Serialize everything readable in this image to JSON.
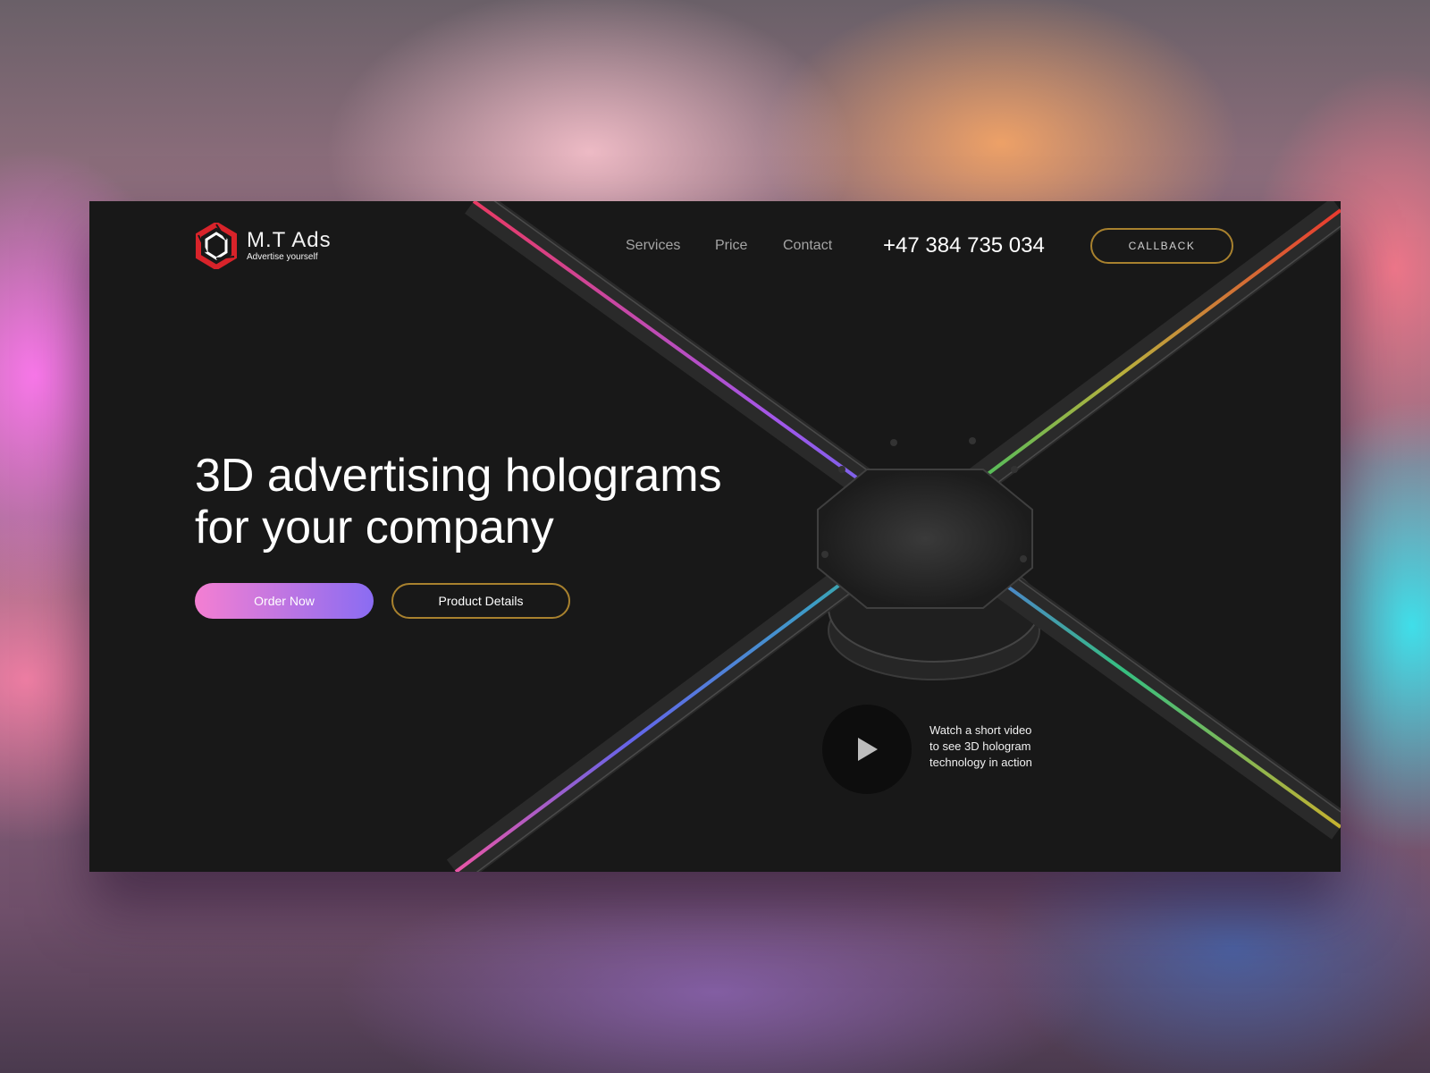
{
  "brand": {
    "name": "M.T Ads",
    "tagline": "Advertise yourself",
    "logo_icon": "hexagon-logo-icon",
    "logo_color": "#d8232a"
  },
  "nav": {
    "items": [
      {
        "label": "Services"
      },
      {
        "label": "Price"
      },
      {
        "label": "Contact"
      }
    ],
    "phone": "+47 384 735 034",
    "callback_label": "CALLBACK"
  },
  "hero": {
    "headline_line1": "3D advertising holograms",
    "headline_line2": "for your company",
    "order_button": "Order Now",
    "details_button": "Product Details"
  },
  "video": {
    "icon": "play-icon",
    "caption_line1": "Watch a short video",
    "caption_line2": "to see 3D hologram",
    "caption_line3": "technology in action"
  },
  "colors": {
    "page_bg": "#181818",
    "accent_gold": "#a8812e",
    "gradient_start": "#f47fd2",
    "gradient_end": "#8a6cf2"
  }
}
